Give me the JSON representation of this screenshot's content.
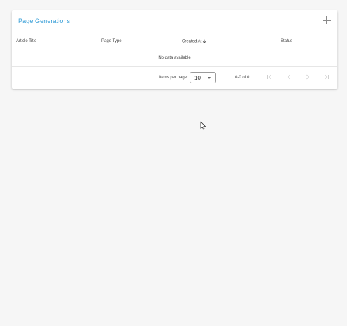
{
  "card": {
    "title": "Page Generations",
    "add_icon": "plus-icon"
  },
  "table": {
    "columns": [
      "Article Title",
      "Page Type",
      "Created At",
      "Status"
    ],
    "sort_icon": "arrow-down-icon",
    "empty_message": "No data available"
  },
  "paginator": {
    "items_per_page_label": "Items per page:",
    "items_per_page_value": "10",
    "range_label": "0-0 of 0",
    "icons": [
      "first-page-icon",
      "chevron-left-icon",
      "chevron-right-icon",
      "last-page-icon"
    ]
  },
  "colors": {
    "accent": "#3aa0d8",
    "background": "#f6f6f6",
    "card": "#ffffff"
  }
}
